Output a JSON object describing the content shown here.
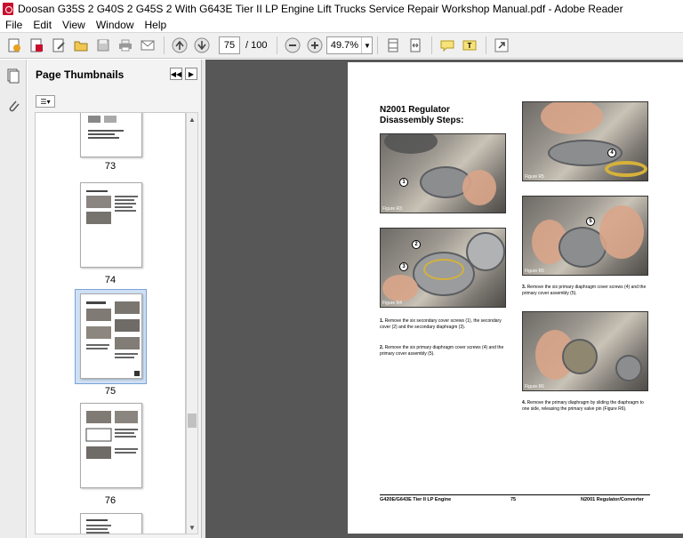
{
  "window": {
    "title": "Doosan G35S 2 G40S 2 G45S 2 With G643E Tier II LP Engine Lift Trucks Service Repair Workshop Manual.pdf - Adobe Reader"
  },
  "menu": [
    "File",
    "Edit",
    "View",
    "Window",
    "Help"
  ],
  "toolbar": {
    "current_page": "75",
    "total_pages": "/ 100",
    "zoom": "49.7%"
  },
  "sidebar": {
    "title": "Page Thumbnails",
    "thumbnails": [
      {
        "label": "73"
      },
      {
        "label": "74"
      },
      {
        "label": "75",
        "selected": true
      },
      {
        "label": "76"
      }
    ]
  },
  "document": {
    "heading_line1": "N2001 Regulator",
    "heading_line2": "Disassembly Steps:",
    "figures": [
      {
        "caption": "Figure R3"
      },
      {
        "caption": "Figure R4"
      },
      {
        "caption": "Figure R5"
      },
      {
        "caption": "Figure R5"
      },
      {
        "caption": "Figure R6"
      }
    ],
    "callouts": [
      "1",
      "2",
      "3",
      "4",
      "5"
    ],
    "steps": [
      {
        "num": "1.",
        "text": "Remove the six secondary cover screws (1), the secondary cover (2) and the secondary diaphragm (3)."
      },
      {
        "num": "2.",
        "text": "Remove the six primary diaphragm cover screws (4) and the primary cover assembly (5)."
      },
      {
        "num": "3.",
        "text": "Remove the six primary diaphragm cover screws (4) and the primary cover assembly (5)."
      },
      {
        "num": "4.",
        "text": "Remove the primary diaphragm by sliding the diaphragm to one side, releasing the primary valve pin (Figure R6)."
      }
    ],
    "footer": {
      "left": "G420E/G643E Tier II LP Engine",
      "center": "75",
      "right": "N2001 Regulator/Converter"
    }
  }
}
